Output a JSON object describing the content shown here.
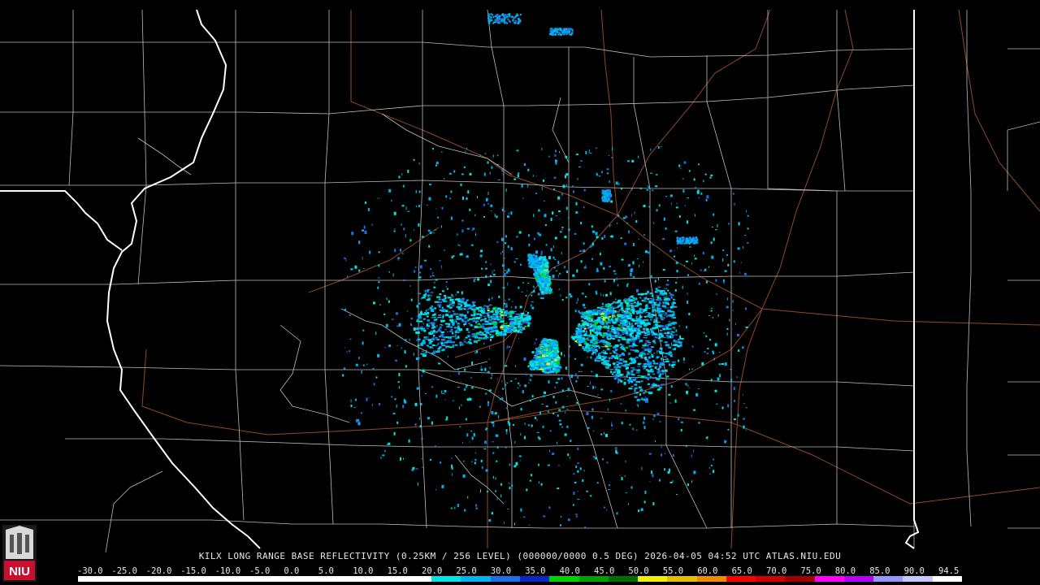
{
  "map": {
    "title": "KILX LONG RANGE BASE REFLECTIVITY (0.25KM / 256 LEVEL) (000000/0000 0.5 DEG) 2026-04-05 04:52 UTC  ATLAS.NIU.EDU",
    "radar_site": "KILX",
    "product": "LONG RANGE BASE REFLECTIVITY",
    "timestamp": "2026-04-05 04:52 UTC",
    "source": "ATLAS.NIU.EDU",
    "logo_text": "NIU",
    "colors": {
      "background": "#000000",
      "county_lines": "#bfbfbf",
      "state_lines": "#ffffff",
      "highways": "#a0522d"
    }
  },
  "scale": {
    "labels": [
      "-30.0",
      "-25.0",
      "-20.0",
      "-15.0",
      "-10.0",
      "-5.0",
      "0.0",
      "5.0",
      "10.0",
      "15.0",
      "20.0",
      "25.0",
      "30.0",
      "35.0",
      "40.0",
      "45.0",
      "50.0",
      "55.0",
      "60.0",
      "65.0",
      "70.0",
      "75.0",
      "80.0",
      "85.0",
      "90.0",
      "94.5"
    ],
    "colors": [
      "#ffffff",
      "#ffffff",
      "#ffffff",
      "#ffffff",
      "#ffffff",
      "#ffffff",
      "#ffffff",
      "#ffffff",
      "#ffffff",
      "#ffffff",
      "#ffffff",
      "#ffffff",
      "#00e5e5",
      "#00b4f0",
      "#1e6ee6",
      "#0a28c8",
      "#00d200",
      "#00a000",
      "#006e00",
      "#f0f000",
      "#e6be00",
      "#f08c00",
      "#ff0000",
      "#d20000",
      "#a00000",
      "#ff00ff",
      "#b400ff",
      "#9696ff",
      "#c8c8ff",
      "#ffffff"
    ]
  }
}
